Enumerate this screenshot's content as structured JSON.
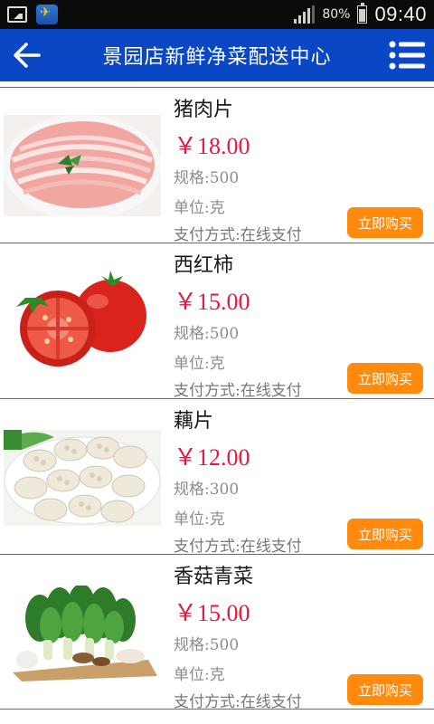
{
  "status_bar": {
    "battery": "80%",
    "time": "09:40"
  },
  "header": {
    "title": "景园店新鲜净菜配送中心"
  },
  "products": [
    {
      "name": "猪肉片",
      "price": "￥18.00",
      "spec": "规格:500",
      "unit": "单位:克",
      "payment": "支付方式:在线支付",
      "buy_label": "立即购买",
      "image": "sliced-pork-image"
    },
    {
      "name": "西红柿",
      "price": "￥15.00",
      "spec": "规格:500",
      "unit": "单位:克",
      "payment": "支付方式:在线支付",
      "buy_label": "立即购买",
      "image": "tomato-image"
    },
    {
      "name": "藕片",
      "price": "￥12.00",
      "spec": "规格:300",
      "unit": "单位:克",
      "payment": "支付方式:在线支付",
      "buy_label": "立即购买",
      "image": "lotus-root-image"
    },
    {
      "name": "香菇青菜",
      "price": "￥15.00",
      "spec": "规格:500",
      "unit": "单位:克",
      "payment": "支付方式:在线支付",
      "buy_label": "立即购买",
      "image": "mushroom-greens-image"
    }
  ],
  "colors": {
    "header_bg": "#0a47c4",
    "price": "#e8173f",
    "buy_button": "#ff8a0d"
  }
}
